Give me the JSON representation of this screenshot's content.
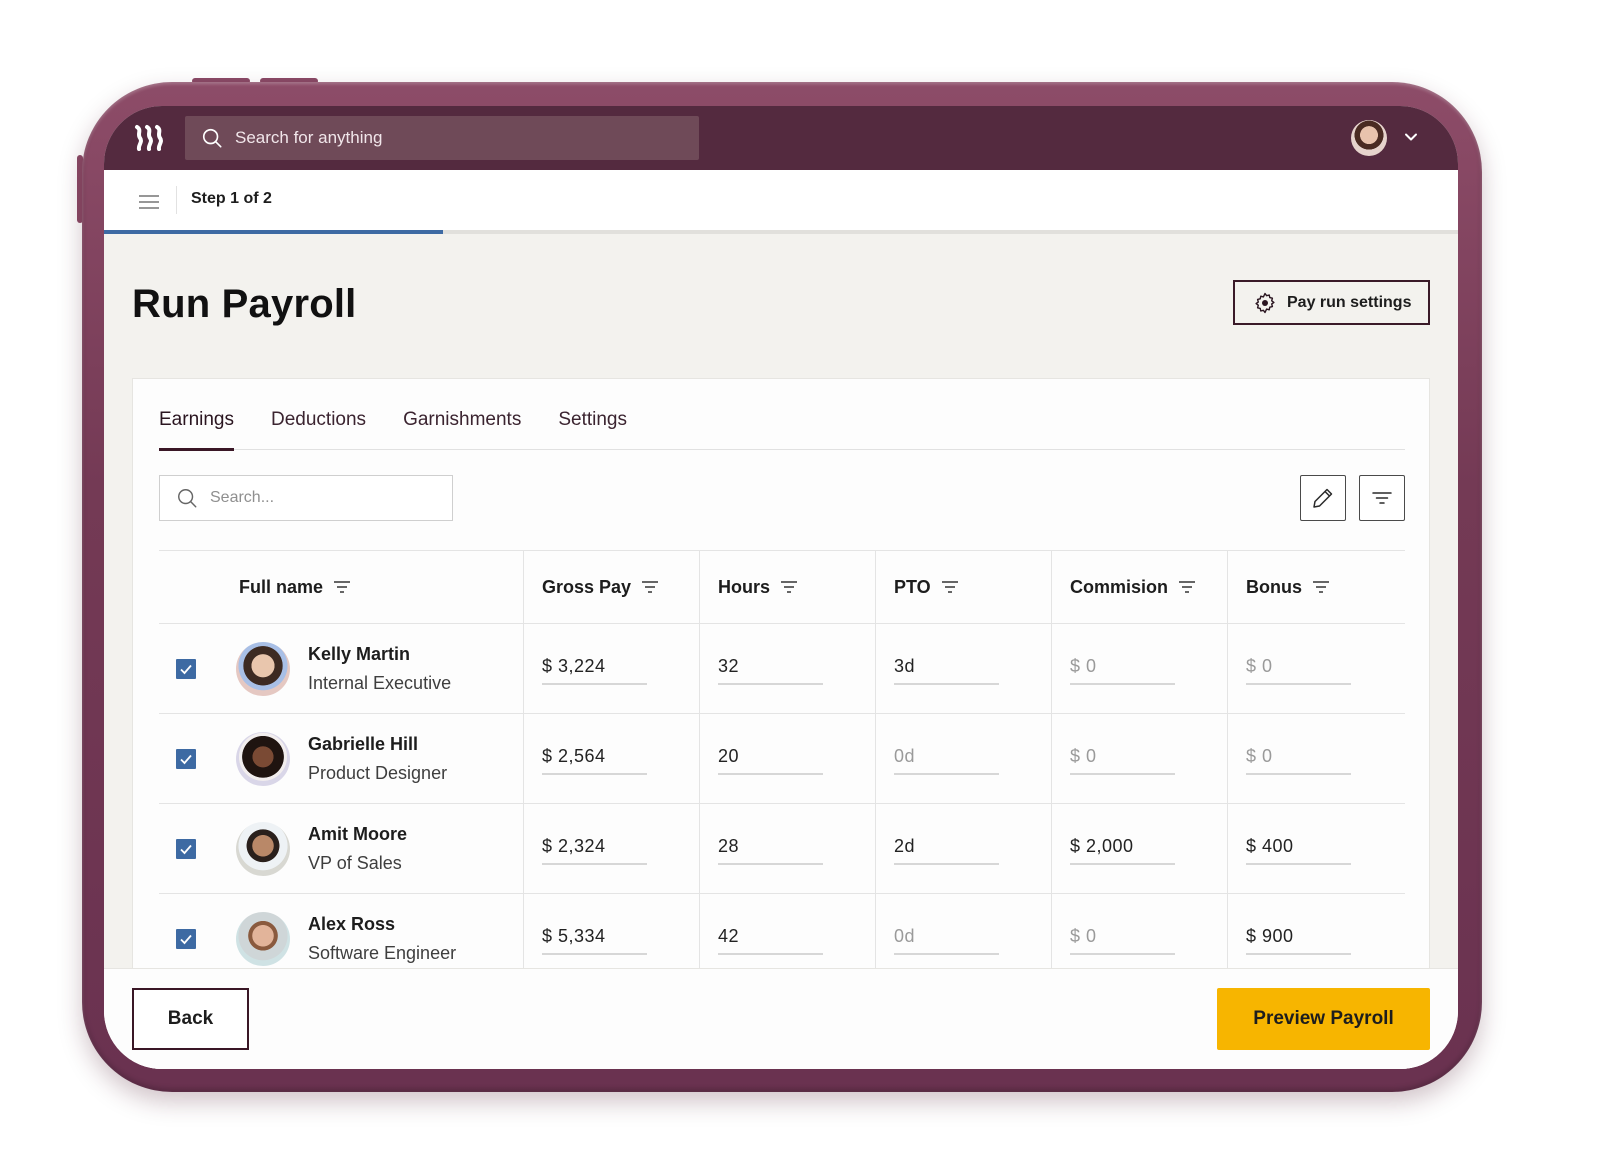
{
  "app": {
    "global_search_placeholder": "Search for anything",
    "logo_icon": "rippling-logo-icon",
    "user_menu_icon": "chevron-down-icon"
  },
  "stepper": {
    "label": "Step 1 of 2",
    "current_step": 1,
    "total_steps": 2,
    "progress_fraction": 0.25
  },
  "page": {
    "title": "Run Payroll",
    "settings_button": "Pay run settings"
  },
  "tabs": [
    {
      "label": "Earnings",
      "active": true
    },
    {
      "label": "Deductions",
      "active": false
    },
    {
      "label": "Garnishments",
      "active": false
    },
    {
      "label": "Settings",
      "active": false
    }
  ],
  "table_search_placeholder": "Search...",
  "toolbar": {
    "edit_icon": "pencil-icon",
    "filter_icon": "filter-icon"
  },
  "table": {
    "columns": [
      "Full name",
      "Gross Pay",
      "Hours",
      "PTO",
      "Commision",
      "Bonus"
    ],
    "rows": [
      {
        "checked": true,
        "name": "Kelly Martin",
        "title": "Internal Executive",
        "gross_pay": "$ 3,224",
        "hours": "32",
        "pto": "3d",
        "commission": "$ 0",
        "bonus": "$ 0"
      },
      {
        "checked": true,
        "name": "Gabrielle Hill",
        "title": "Product Designer",
        "gross_pay": "$ 2,564",
        "hours": "20",
        "pto": "0d",
        "commission": "$ 0",
        "bonus": "$ 0"
      },
      {
        "checked": true,
        "name": "Amit Moore",
        "title": "VP of Sales",
        "gross_pay": "$ 2,324",
        "hours": "28",
        "pto": "2d",
        "commission": "$ 2,000",
        "bonus": "$ 400"
      },
      {
        "checked": true,
        "name": "Alex Ross",
        "title": "Software Engineer",
        "gross_pay": "$ 5,334",
        "hours": "42",
        "pto": "0d",
        "commission": "$ 0",
        "bonus": "$ 900"
      }
    ]
  },
  "footer": {
    "back_label": "Back",
    "preview_label": "Preview Payroll"
  },
  "colors": {
    "brand_dark": "#542a3f",
    "device_frame": "#743a55",
    "accent_blue": "#3d6aa3",
    "primary_button": "#f7b500"
  }
}
